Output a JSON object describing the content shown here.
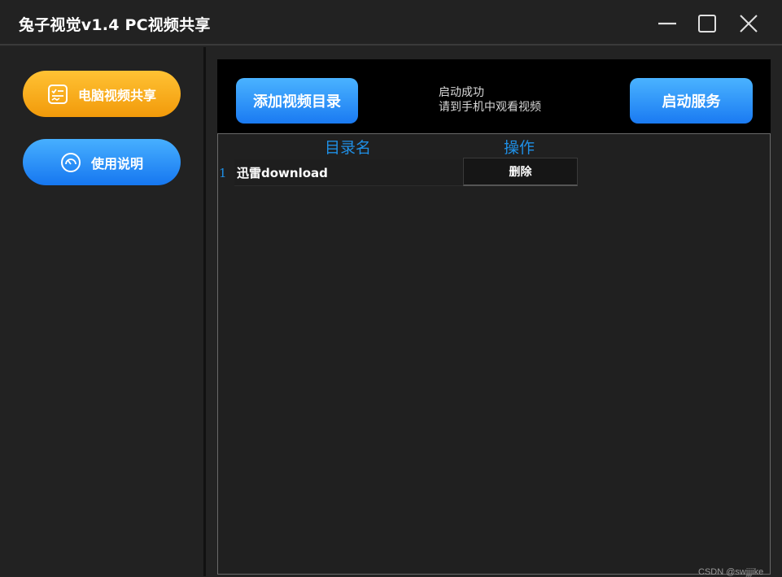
{
  "window": {
    "title": "兔子视觉v1.4 PC视频共享",
    "controls": {
      "minimize_icon": "minimize-icon",
      "maximize_icon": "maximize-icon",
      "close_icon": "close-icon"
    }
  },
  "sidebar": {
    "items": [
      {
        "label": "电脑视频共享",
        "icon": "checklist-icon",
        "color": "#f6a913",
        "active": true
      },
      {
        "label": "使用说明",
        "icon": "gauge-icon",
        "color": "#2a8ef7",
        "active": false
      }
    ]
  },
  "toolbar": {
    "add_dir_label": "添加视频目录",
    "start_label": "启动服务",
    "status_line1": "启动成功",
    "status_line2": "请到手机中观看视频"
  },
  "table": {
    "columns": [
      "目录名",
      "操作"
    ],
    "rows": [
      {
        "index": "1",
        "name": "迅雷download",
        "action": "删除"
      }
    ]
  },
  "watermark": "CSDN @swjjjike",
  "colors": {
    "accent_blue": "#1f8fe5",
    "accent_orange": "#f6a913",
    "background": "#232323"
  }
}
